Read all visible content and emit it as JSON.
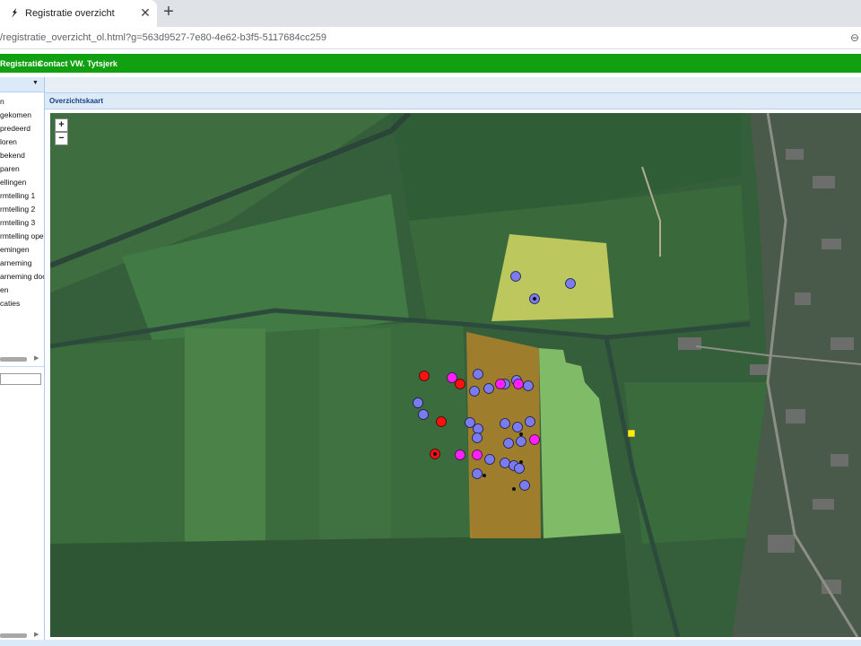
{
  "browser": {
    "tab_title": "Registratie overzicht",
    "close_glyph": "✕",
    "new_tab_glyph": "+",
    "url": "/registratie_overzicht_ol.html?g=563d9527-7e80-4e62-b3f5-5117684cc259",
    "menu_glyph": "⊖"
  },
  "nav": {
    "items": [
      "Registratie",
      "Contact",
      "VW. Tytsjerk"
    ]
  },
  "sidebar": {
    "collapse_glyph": "▼",
    "items": [
      "n",
      "gekomen",
      "predeerd",
      "loren",
      "bekend",
      "paren",
      "ellingen",
      "rmtelling 1",
      "rmtelling 2",
      "rmtelling 3",
      "rmtelling oper",
      "emingen",
      "arneming",
      "arneming doo",
      "en",
      "caties"
    ],
    "search_value": ""
  },
  "map": {
    "title": "Overzichtskaart",
    "zoom_in": "+",
    "zoom_out": "−",
    "colors": {
      "blue": "#7b7bf0",
      "magenta": "#ff20ff",
      "red": "#ff1010",
      "yellow_area": "#e8e86a",
      "orange_area": "#c88a28",
      "green_area": "#9adc78",
      "marker": "#ffee00"
    }
  }
}
